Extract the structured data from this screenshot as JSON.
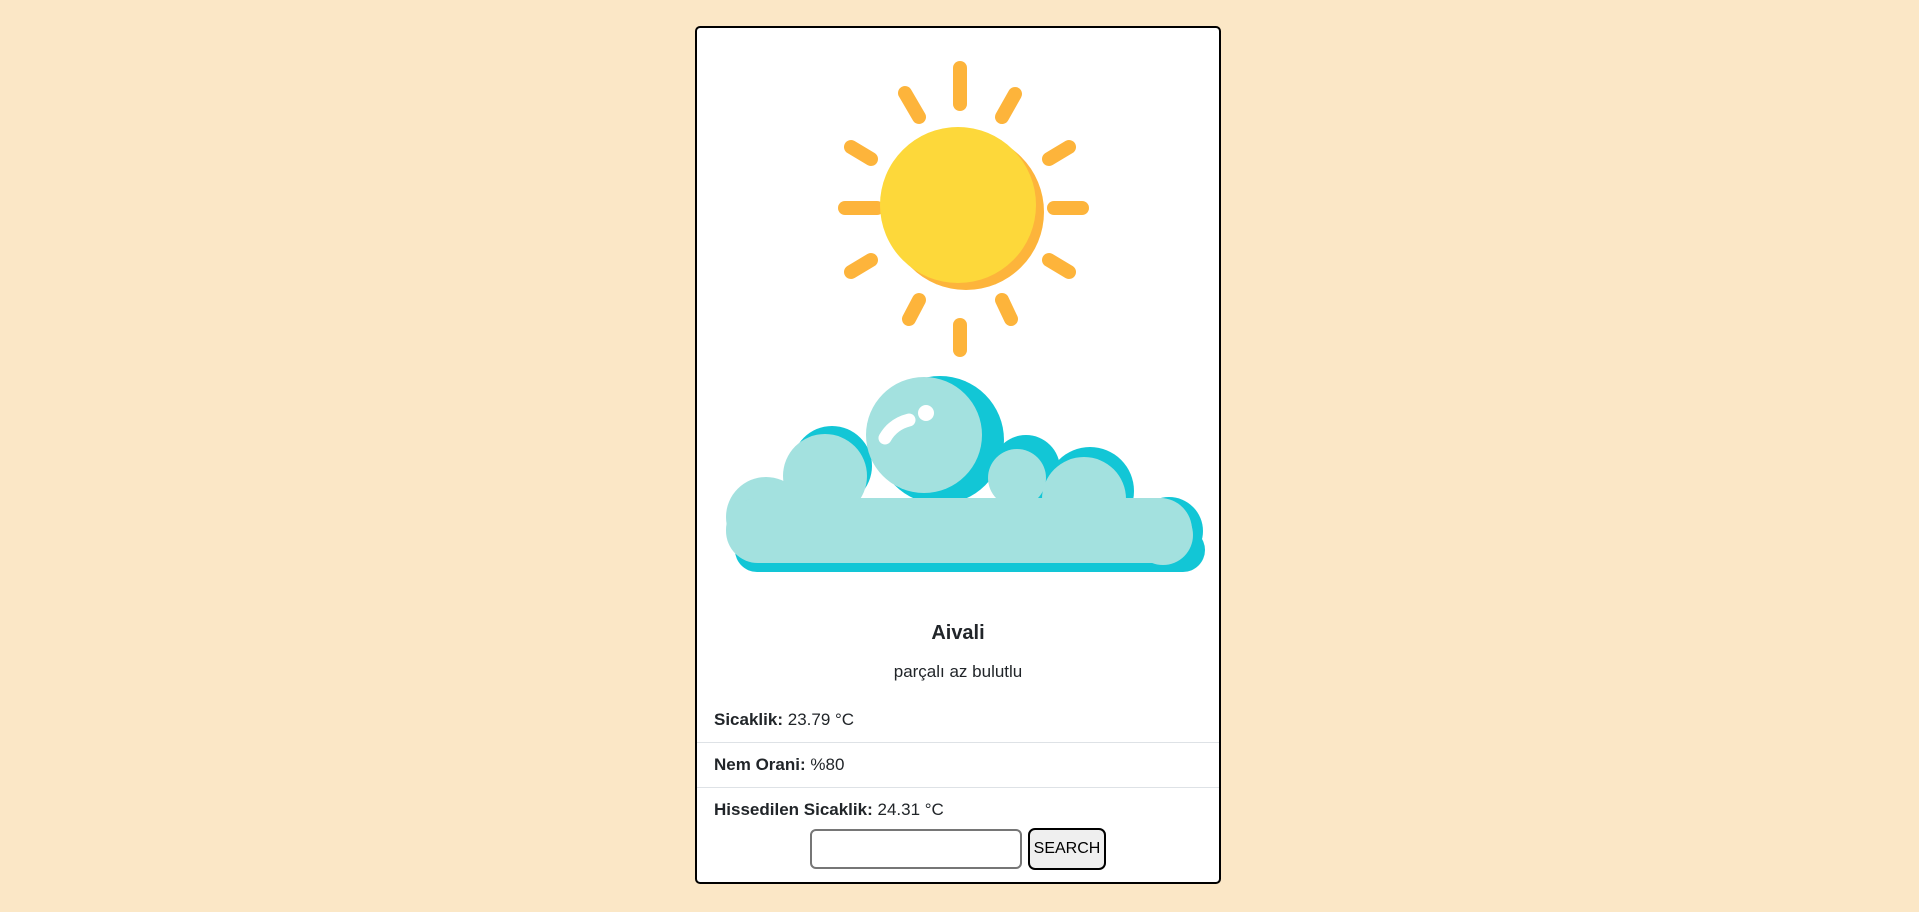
{
  "weather": {
    "city": "Aivali",
    "description": "parçalı az bulutlu",
    "icon": "partly-cloudy-icon",
    "details": [
      {
        "label": "Sicaklik:",
        "value": "23.79 °C"
      },
      {
        "label": "Nem Orani:",
        "value": "%80"
      },
      {
        "label": "Hissedilen Sicaklik:",
        "value": "24.31 °C"
      }
    ]
  },
  "search": {
    "value": "",
    "placeholder": "",
    "button_label": "SEARCH"
  },
  "colors": {
    "background": "#fbe7c6",
    "sun": "#fdd83a",
    "sun_rays": "#fdb43b",
    "cloud": "#a3e1df",
    "cloud_shadow": "#12c6d6"
  }
}
